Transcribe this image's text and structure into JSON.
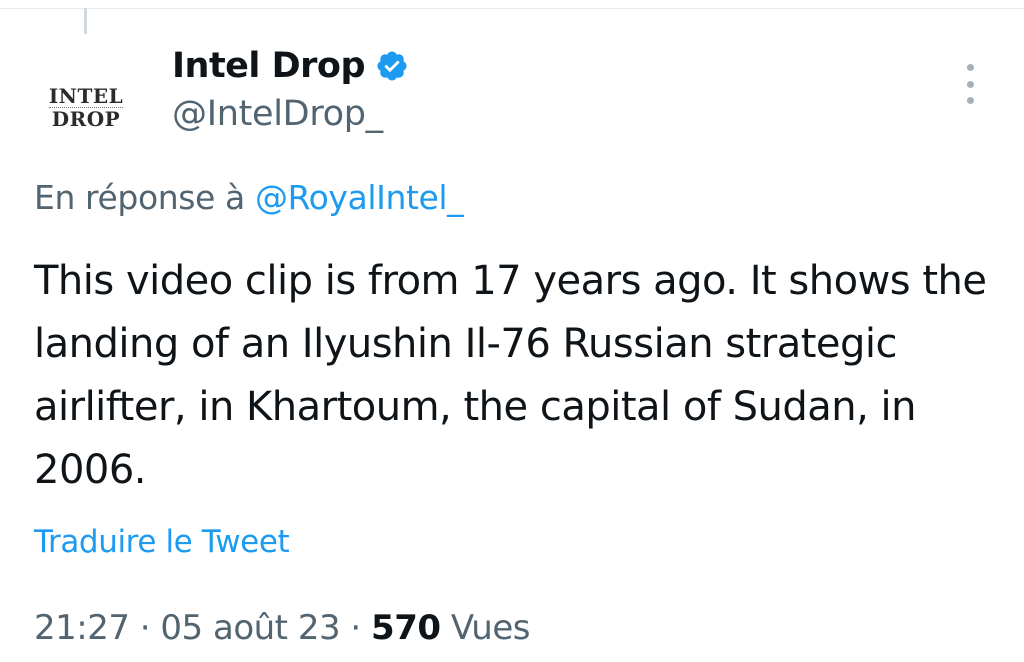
{
  "thread": {},
  "author": {
    "avatar_line1": "INTEL",
    "avatar_line2": "DROP",
    "display_name": "Intel Drop",
    "handle": "@IntelDrop_",
    "verified_icon": "verified-badge-icon",
    "more_icon": "more-vertical-icon"
  },
  "reply": {
    "prefix": "En réponse à",
    "mention": "@RoyalIntel_"
  },
  "tweet": {
    "text": "This video clip is from 17 years ago. It shows the landing of an Ilyushin Il-76 Russian strategic airlifter, in Khartoum, the capital of Sudan, in 2006.",
    "translate_label": "Traduire le Tweet"
  },
  "meta": {
    "time": "21:27",
    "separator": "·",
    "date": "05 août 23",
    "views_count": "570",
    "views_label": "Vues"
  },
  "colors": {
    "accent": "#1d9bf0",
    "text_primary": "#0f1419",
    "text_secondary": "#536471"
  }
}
